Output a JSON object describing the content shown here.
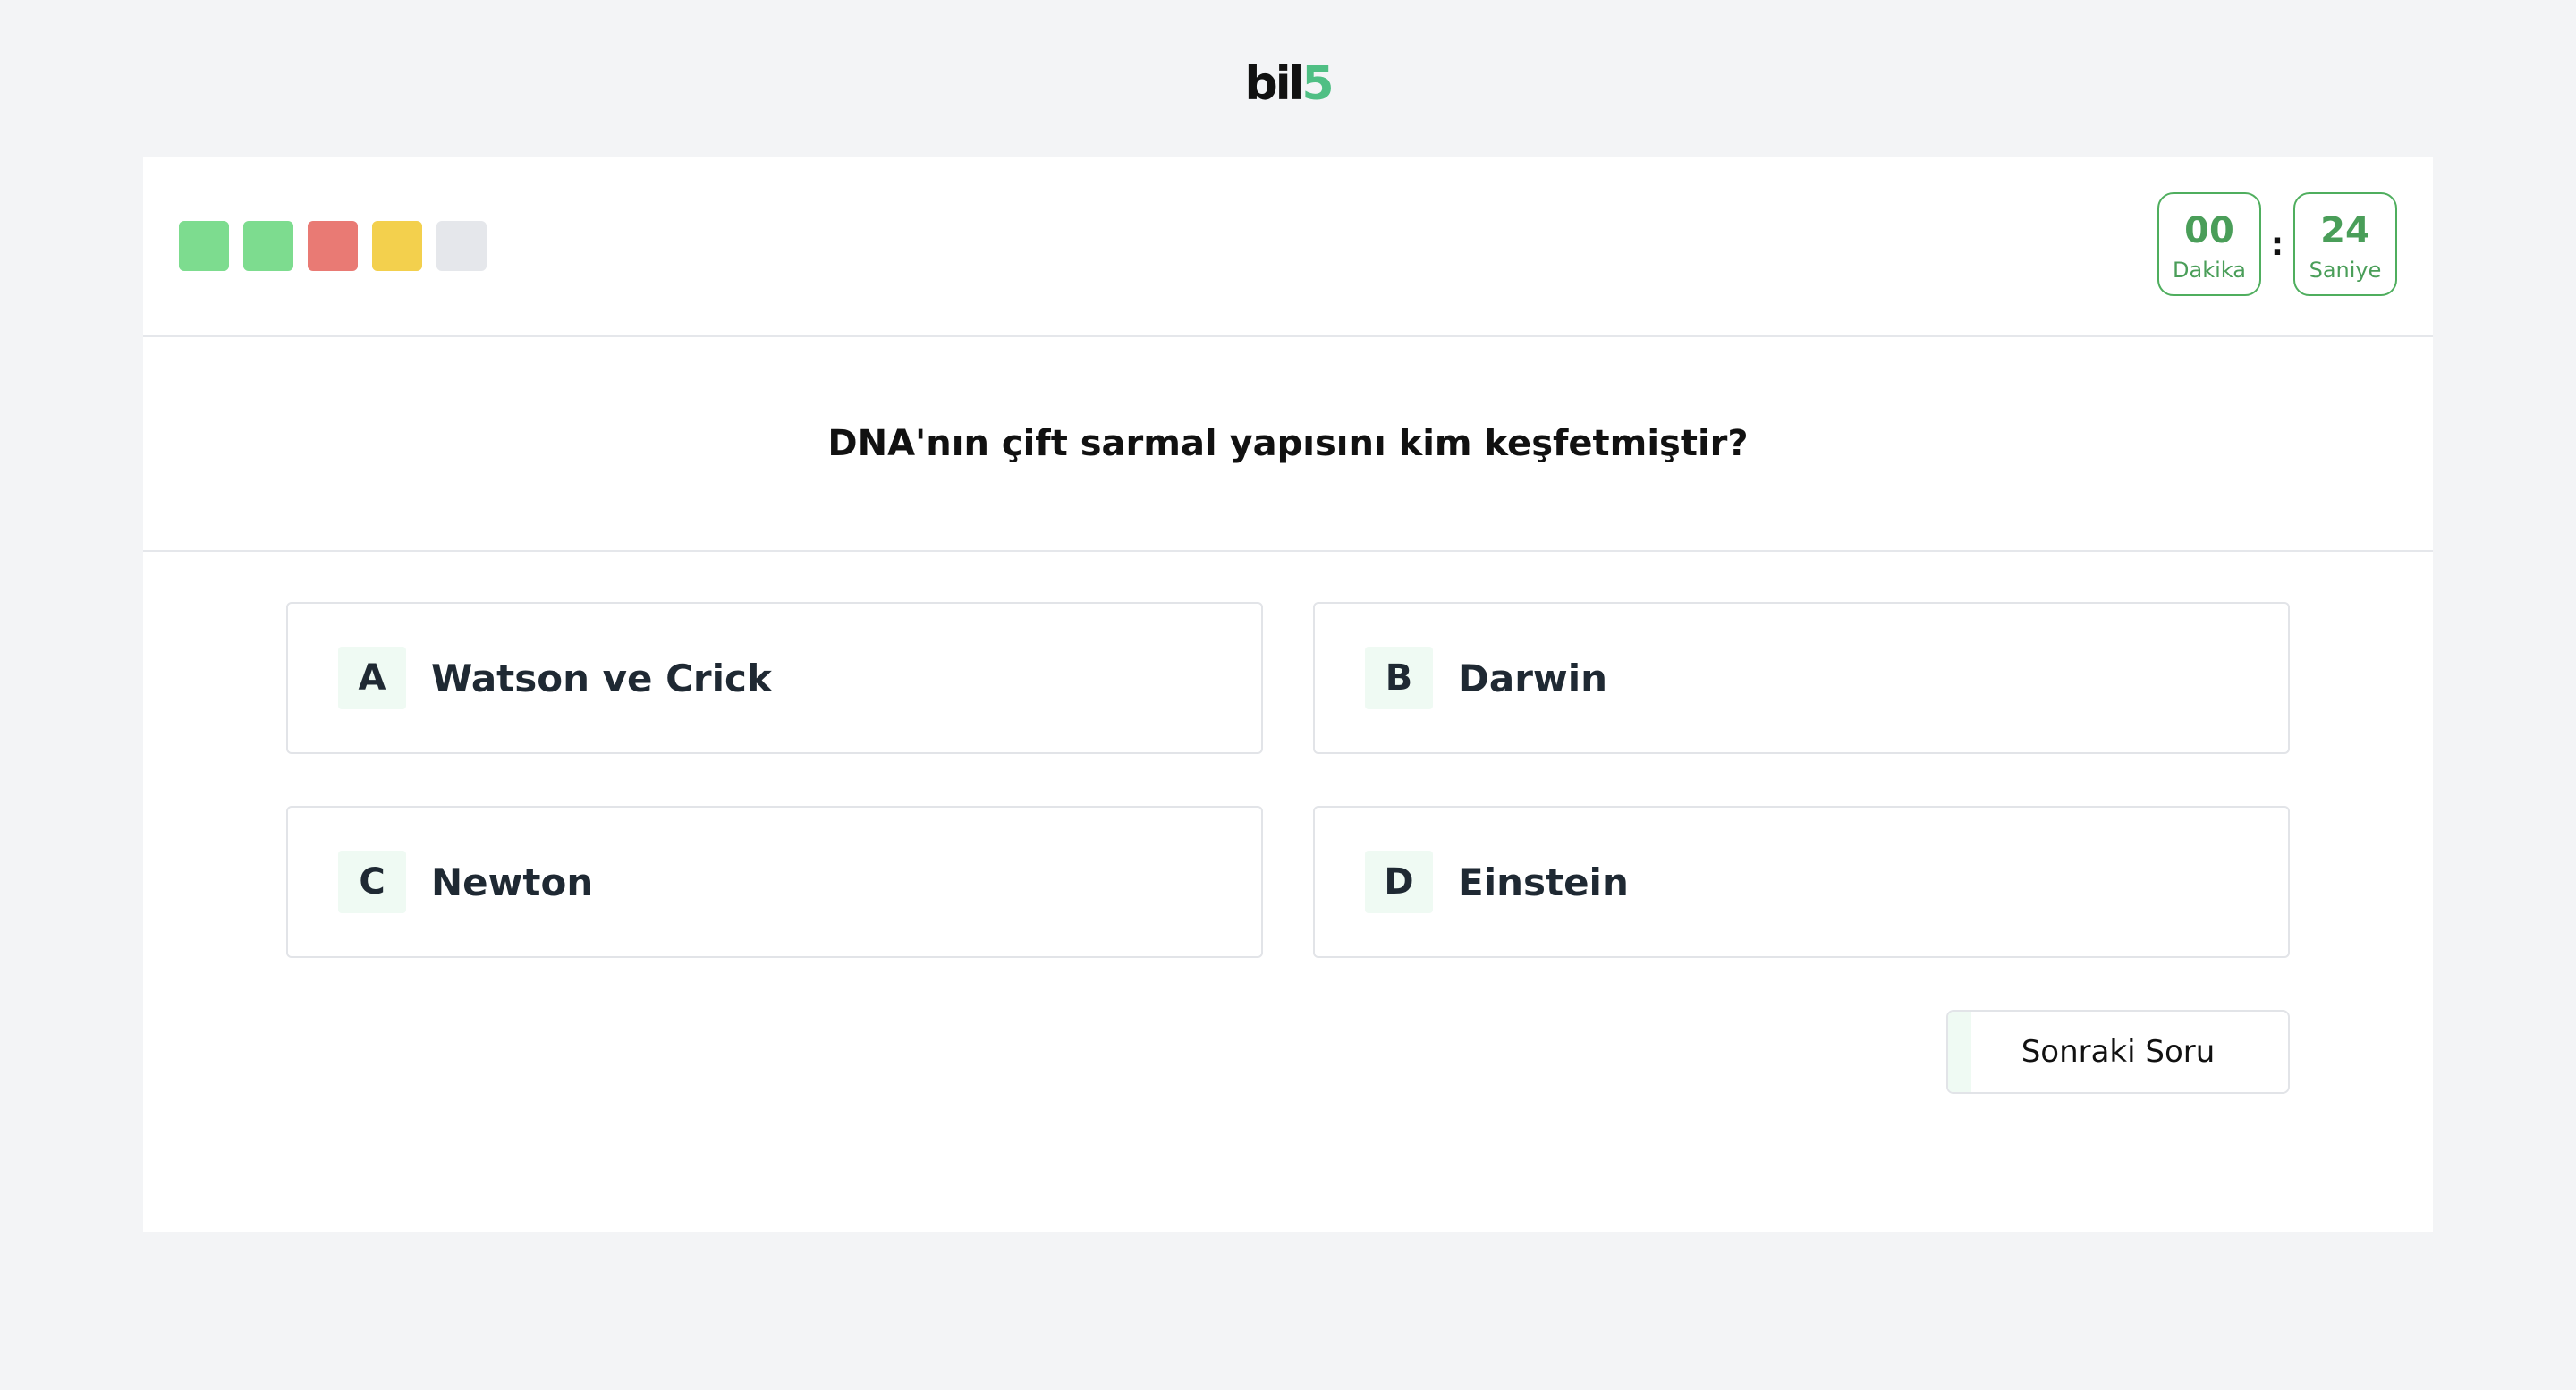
{
  "logo": {
    "main": "bil",
    "accent": "5"
  },
  "progress": [
    {
      "status": "correct",
      "color": "#7ddc8f"
    },
    {
      "status": "correct",
      "color": "#7ddc8f"
    },
    {
      "status": "wrong",
      "color": "#e97a74"
    },
    {
      "status": "skipped",
      "color": "#f3d04d"
    },
    {
      "status": "pending",
      "color": "#e5e7eb"
    }
  ],
  "timer": {
    "minutes": "00",
    "minutes_label": "Dakika",
    "separator": ":",
    "seconds": "24",
    "seconds_label": "Saniye"
  },
  "question": "DNA'nın çift sarmal yapısını kim keşfetmiştir?",
  "options": [
    {
      "letter": "A",
      "text": "Watson ve Crick"
    },
    {
      "letter": "B",
      "text": "Darwin"
    },
    {
      "letter": "C",
      "text": "Newton"
    },
    {
      "letter": "D",
      "text": "Einstein"
    }
  ],
  "next_button": "Sonraki Soru"
}
